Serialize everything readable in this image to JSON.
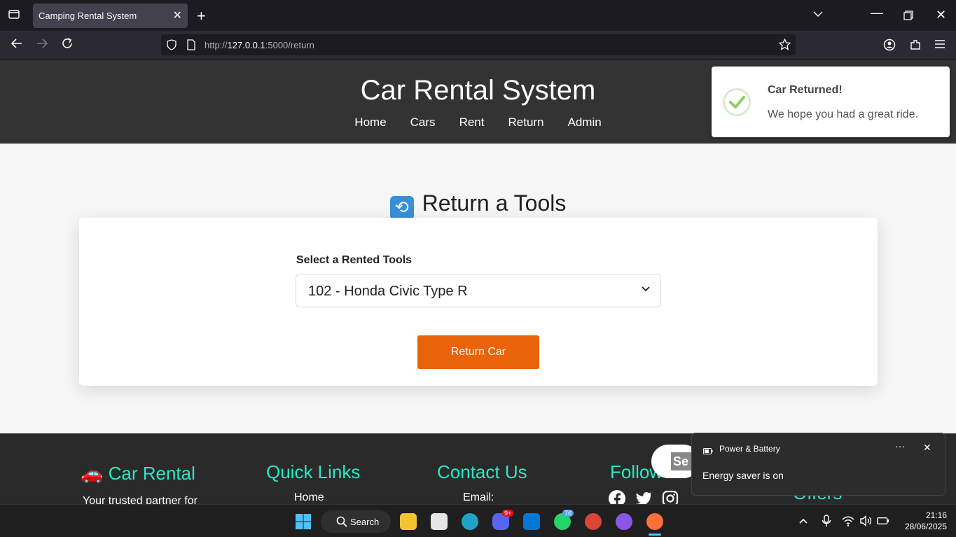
{
  "browser": {
    "tab_title": "Camping Rental System",
    "url_prefix": "http://",
    "url_host": "127.0.0.1",
    "url_path": ":5000/return"
  },
  "header": {
    "title": "Car Rental System",
    "nav": [
      "Home",
      "Cars",
      "Rent",
      "Return",
      "Admin"
    ]
  },
  "toast": {
    "title": "Car Returned!",
    "message": "We hope you had a great ride."
  },
  "main": {
    "heading": "Return a Tools",
    "select_label": "Select a Rented Tools",
    "selected_option": "102 - Honda Civic Type R",
    "button_label": "Return Car"
  },
  "footer": {
    "brand": "Car Rental",
    "brand_icon": "🚗",
    "brand_text": "Your trusted partner for",
    "quick_links_heading": "Quick Links",
    "quick_link_1": "Home",
    "contact_heading": "Contact Us",
    "contact_email_label": "Email:",
    "follow_heading": "Follow",
    "offers_heading": "Offers",
    "pill_text": "Se",
    "social_icons": [
      "facebook-icon",
      "twitter-icon",
      "instagram-icon"
    ]
  },
  "notification": {
    "app": "Power & Battery",
    "message": "Energy saver is on"
  },
  "taskbar": {
    "search_label": "Search",
    "discord_badge": "9+",
    "whatsapp_badge": "76",
    "time": "21:16",
    "date": "28/06/2025"
  },
  "colors": {
    "accent": "#e8630a",
    "header_bg": "#333333",
    "footer_heading": "#2ee6c4"
  }
}
